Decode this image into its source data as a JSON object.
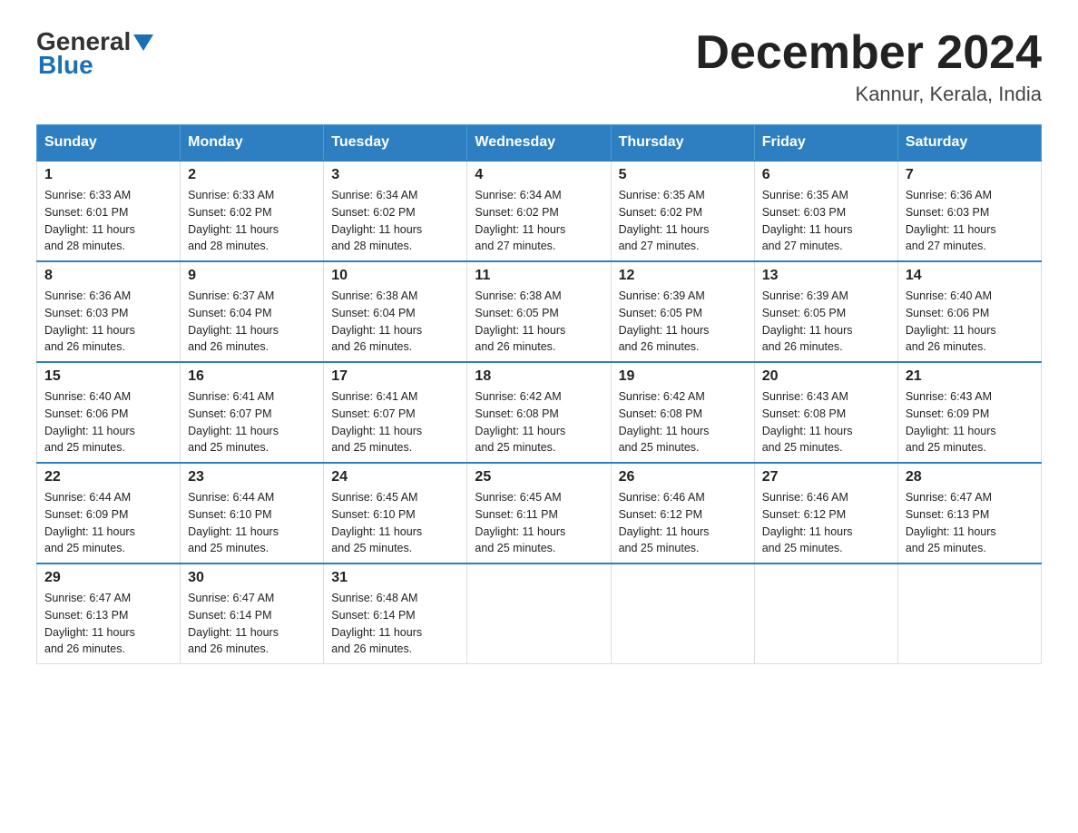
{
  "logo": {
    "general": "General",
    "arrow": "▲",
    "blue": "Blue"
  },
  "title": "December 2024",
  "subtitle": "Kannur, Kerala, India",
  "headers": [
    "Sunday",
    "Monday",
    "Tuesday",
    "Wednesday",
    "Thursday",
    "Friday",
    "Saturday"
  ],
  "weeks": [
    [
      {
        "day": "1",
        "sunrise": "6:33 AM",
        "sunset": "6:01 PM",
        "daylight": "11 hours and 28 minutes."
      },
      {
        "day": "2",
        "sunrise": "6:33 AM",
        "sunset": "6:02 PM",
        "daylight": "11 hours and 28 minutes."
      },
      {
        "day": "3",
        "sunrise": "6:34 AM",
        "sunset": "6:02 PM",
        "daylight": "11 hours and 28 minutes."
      },
      {
        "day": "4",
        "sunrise": "6:34 AM",
        "sunset": "6:02 PM",
        "daylight": "11 hours and 27 minutes."
      },
      {
        "day": "5",
        "sunrise": "6:35 AM",
        "sunset": "6:02 PM",
        "daylight": "11 hours and 27 minutes."
      },
      {
        "day": "6",
        "sunrise": "6:35 AM",
        "sunset": "6:03 PM",
        "daylight": "11 hours and 27 minutes."
      },
      {
        "day": "7",
        "sunrise": "6:36 AM",
        "sunset": "6:03 PM",
        "daylight": "11 hours and 27 minutes."
      }
    ],
    [
      {
        "day": "8",
        "sunrise": "6:36 AM",
        "sunset": "6:03 PM",
        "daylight": "11 hours and 26 minutes."
      },
      {
        "day": "9",
        "sunrise": "6:37 AM",
        "sunset": "6:04 PM",
        "daylight": "11 hours and 26 minutes."
      },
      {
        "day": "10",
        "sunrise": "6:38 AM",
        "sunset": "6:04 PM",
        "daylight": "11 hours and 26 minutes."
      },
      {
        "day": "11",
        "sunrise": "6:38 AM",
        "sunset": "6:05 PM",
        "daylight": "11 hours and 26 minutes."
      },
      {
        "day": "12",
        "sunrise": "6:39 AM",
        "sunset": "6:05 PM",
        "daylight": "11 hours and 26 minutes."
      },
      {
        "day": "13",
        "sunrise": "6:39 AM",
        "sunset": "6:05 PM",
        "daylight": "11 hours and 26 minutes."
      },
      {
        "day": "14",
        "sunrise": "6:40 AM",
        "sunset": "6:06 PM",
        "daylight": "11 hours and 26 minutes."
      }
    ],
    [
      {
        "day": "15",
        "sunrise": "6:40 AM",
        "sunset": "6:06 PM",
        "daylight": "11 hours and 25 minutes."
      },
      {
        "day": "16",
        "sunrise": "6:41 AM",
        "sunset": "6:07 PM",
        "daylight": "11 hours and 25 minutes."
      },
      {
        "day": "17",
        "sunrise": "6:41 AM",
        "sunset": "6:07 PM",
        "daylight": "11 hours and 25 minutes."
      },
      {
        "day": "18",
        "sunrise": "6:42 AM",
        "sunset": "6:08 PM",
        "daylight": "11 hours and 25 minutes."
      },
      {
        "day": "19",
        "sunrise": "6:42 AM",
        "sunset": "6:08 PM",
        "daylight": "11 hours and 25 minutes."
      },
      {
        "day": "20",
        "sunrise": "6:43 AM",
        "sunset": "6:08 PM",
        "daylight": "11 hours and 25 minutes."
      },
      {
        "day": "21",
        "sunrise": "6:43 AM",
        "sunset": "6:09 PM",
        "daylight": "11 hours and 25 minutes."
      }
    ],
    [
      {
        "day": "22",
        "sunrise": "6:44 AM",
        "sunset": "6:09 PM",
        "daylight": "11 hours and 25 minutes."
      },
      {
        "day": "23",
        "sunrise": "6:44 AM",
        "sunset": "6:10 PM",
        "daylight": "11 hours and 25 minutes."
      },
      {
        "day": "24",
        "sunrise": "6:45 AM",
        "sunset": "6:10 PM",
        "daylight": "11 hours and 25 minutes."
      },
      {
        "day": "25",
        "sunrise": "6:45 AM",
        "sunset": "6:11 PM",
        "daylight": "11 hours and 25 minutes."
      },
      {
        "day": "26",
        "sunrise": "6:46 AM",
        "sunset": "6:12 PM",
        "daylight": "11 hours and 25 minutes."
      },
      {
        "day": "27",
        "sunrise": "6:46 AM",
        "sunset": "6:12 PM",
        "daylight": "11 hours and 25 minutes."
      },
      {
        "day": "28",
        "sunrise": "6:47 AM",
        "sunset": "6:13 PM",
        "daylight": "11 hours and 25 minutes."
      }
    ],
    [
      {
        "day": "29",
        "sunrise": "6:47 AM",
        "sunset": "6:13 PM",
        "daylight": "11 hours and 26 minutes."
      },
      {
        "day": "30",
        "sunrise": "6:47 AM",
        "sunset": "6:14 PM",
        "daylight": "11 hours and 26 minutes."
      },
      {
        "day": "31",
        "sunrise": "6:48 AM",
        "sunset": "6:14 PM",
        "daylight": "11 hours and 26 minutes."
      },
      null,
      null,
      null,
      null
    ]
  ],
  "labels": {
    "sunrise": "Sunrise:",
    "sunset": "Sunset:",
    "daylight": "Daylight:"
  }
}
